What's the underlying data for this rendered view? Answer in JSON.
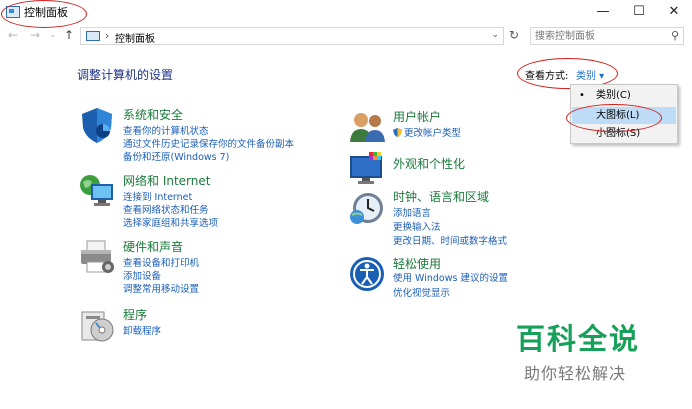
{
  "window": {
    "title": "控制面板",
    "minimize": "—",
    "maximize": "☐",
    "close": "✕"
  },
  "address": {
    "back": "←",
    "forward": "→",
    "up": "↑",
    "separator": "›",
    "path": "控制面板",
    "dropdown": "⌄",
    "refresh": "↻",
    "search_placeholder": "搜索控制面板"
  },
  "header": {
    "title": "调整计算机的设置",
    "view_by_label": "查看方式:",
    "view_by_value": "类别 ▾"
  },
  "view_menu": {
    "items": [
      {
        "label": "类别(C)",
        "selected": true
      },
      {
        "label": "大图标(L)",
        "highlighted": true
      },
      {
        "label": "小图标(S)"
      }
    ],
    "bullet": "•"
  },
  "categories_left": [
    {
      "title": "系统和安全",
      "icon": "shield-icon",
      "links": [
        "查看你的计算机状态",
        "通过文件历史记录保存你的文件备份副本",
        "备份和还原(Windows 7)"
      ]
    },
    {
      "title": "网络和 Internet",
      "icon": "network-icon",
      "links": [
        "连接到 Internet",
        "查看网络状态和任务",
        "选择家庭组和共享选项"
      ]
    },
    {
      "title": "硬件和声音",
      "icon": "printer-icon",
      "links": [
        "查看设备和打印机",
        "添加设备",
        "调整常用移动设置"
      ]
    },
    {
      "title": "程序",
      "icon": "programs-icon",
      "links": [
        "卸载程序"
      ]
    }
  ],
  "categories_right": [
    {
      "title": "用户帐户",
      "icon": "users-icon",
      "links": [
        "更改帐户类型"
      ]
    },
    {
      "title": "外观和个性化",
      "icon": "appearance-icon",
      "links": []
    },
    {
      "title": "时钟、语言和区域",
      "icon": "clock-icon",
      "links": [
        "添加语言",
        "更换输入法",
        "更改日期、时间或数字格式"
      ]
    },
    {
      "title": "轻松使用",
      "icon": "ease-of-access-icon",
      "links": [
        "使用 Windows 建议的设置",
        "优化视觉显示"
      ]
    }
  ],
  "watermark": {
    "title": "百科全说",
    "subtitle": "助你轻松解决"
  },
  "colors": {
    "category_title": "#1a7a3b",
    "link": "#1c5fb8",
    "page_title": "#1e3287",
    "annotation": "#d21f1f",
    "watermark": "#17a05a"
  }
}
